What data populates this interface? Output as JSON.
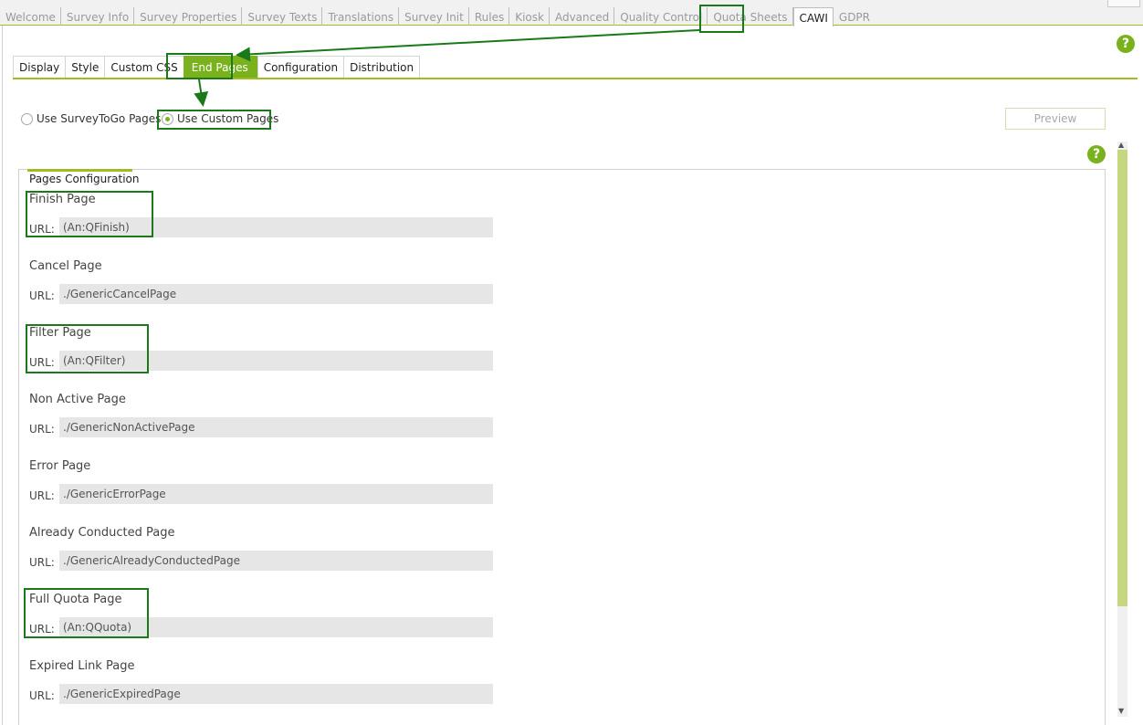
{
  "top_tabs": [
    "Welcome",
    "Survey Info",
    "Survey Properties",
    "Survey Texts",
    "Translations",
    "Survey Init",
    "Rules",
    "Kiosk",
    "Advanced",
    "Quality Control",
    "Quota Sheets",
    "CAWI",
    "GDPR"
  ],
  "top_tab_active": "CAWI",
  "sub_tabs": [
    "Display",
    "Style",
    "Custom CSS",
    "End Pages",
    "Configuration",
    "Distribution"
  ],
  "sub_tab_active": "End Pages",
  "radios": {
    "option1": "Use SurveyToGo Pages",
    "option2": "Use Custom Pages",
    "selected": "Use Custom Pages"
  },
  "preview_label": "Preview",
  "help_glyph": "?",
  "panel_title": "Pages Configuration",
  "url_label": "URL:",
  "pages": [
    {
      "title": "Finish Page",
      "url": "(An:QFinish)"
    },
    {
      "title": "Cancel Page",
      "url": "./GenericCancelPage"
    },
    {
      "title": "Filter Page",
      "url": "(An:QFilter)"
    },
    {
      "title": "Non Active Page",
      "url": "./GenericNonActivePage"
    },
    {
      "title": "Error Page",
      "url": "./GenericErrorPage"
    },
    {
      "title": "Already Conducted Page",
      "url": "./GenericAlreadyConductedPage"
    },
    {
      "title": "Full Quota Page",
      "url": "(An:QQuota)"
    },
    {
      "title": "Expired Link Page",
      "url": "./GenericExpiredPage"
    }
  ],
  "colors": {
    "accent": "#7ab21d",
    "highlight": "#1a7a1a"
  }
}
